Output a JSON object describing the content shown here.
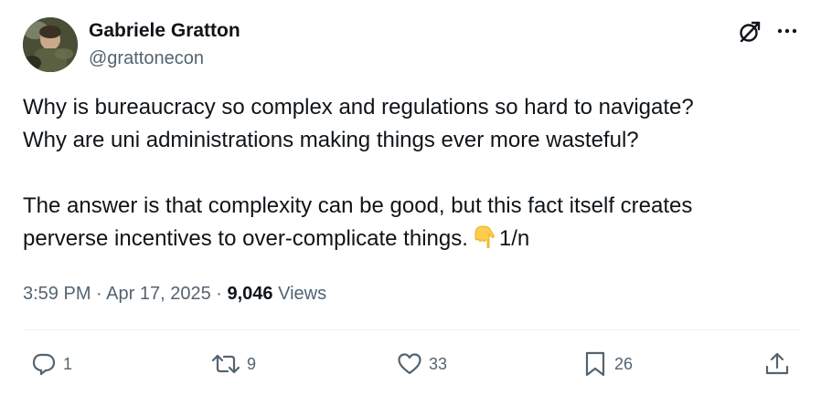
{
  "author": {
    "name": "Gabriele Gratton",
    "handle": "@grattonecon"
  },
  "icons": {
    "grok": "grok-icon",
    "more": "more-icon",
    "reply": "reply-icon",
    "retweet": "retweet-icon",
    "like": "heart-icon",
    "bookmark": "bookmark-icon",
    "share": "share-icon",
    "emoji": "backhand-index-pointing-down-emoji"
  },
  "tweet": {
    "lines": [
      "Why is bureaucracy so complex and regulations so hard to navigate?",
      "Why are uni administrations making things ever more wasteful?",
      "The answer is that complexity can be good, but this fact itself creates",
      "perverse incentives to over-complicate things."
    ],
    "thread_marker": "1/n"
  },
  "meta": {
    "time": "3:59 PM",
    "separator": "·",
    "date": "Apr 17, 2025",
    "views_count": "9,046",
    "views_label": "Views"
  },
  "actions": {
    "replies": "1",
    "retweets": "9",
    "likes": "33",
    "bookmarks": "26"
  },
  "colors": {
    "text": "#0f1419",
    "secondary": "#536471",
    "divider": "#eff3f4",
    "emoji": "#ffcc4d"
  }
}
